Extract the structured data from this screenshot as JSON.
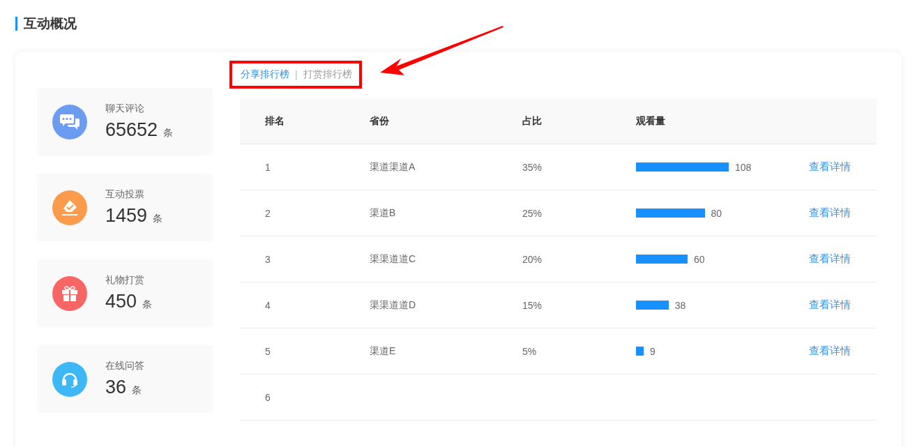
{
  "section_title": "互动概况",
  "stats": [
    {
      "kind": "chat",
      "label": "聊天评论",
      "value": "65652",
      "unit": "条",
      "color": "#6c9cf2"
    },
    {
      "kind": "vote",
      "label": "互动投票",
      "value": "1459",
      "unit": "条",
      "color": "#fd9b4c"
    },
    {
      "kind": "gift",
      "label": "礼物打赏",
      "value": "450",
      "unit": "条",
      "color": "#f76565"
    },
    {
      "kind": "headset",
      "label": "在线问答",
      "value": "36",
      "unit": "条",
      "color": "#3db8f7"
    }
  ],
  "tabs": [
    {
      "label": "分享排行榜",
      "selected": true
    },
    {
      "label": "打赏排行榜",
      "selected": false
    }
  ],
  "tab_separator": "|",
  "table": {
    "columns": [
      "排名",
      "省份",
      "占比",
      "观看量"
    ],
    "rows": [
      {
        "rank": "1",
        "name": "渠道渠道A",
        "share": "35%",
        "views": "108",
        "action": "查看详情"
      },
      {
        "rank": "2",
        "name": "渠道B",
        "share": "25%",
        "views": "80",
        "action": "查看详情"
      },
      {
        "rank": "3",
        "name": "渠渠道道C",
        "share": "20%",
        "views": "60",
        "action": "查看详情"
      },
      {
        "rank": "4",
        "name": "渠渠道道D",
        "share": "15%",
        "views": "38",
        "action": "查看详情"
      },
      {
        "rank": "5",
        "name": "渠道E",
        "share": "5%",
        "views": "9",
        "action": "查看详情"
      },
      {
        "rank": "6"
      }
    ]
  }
}
